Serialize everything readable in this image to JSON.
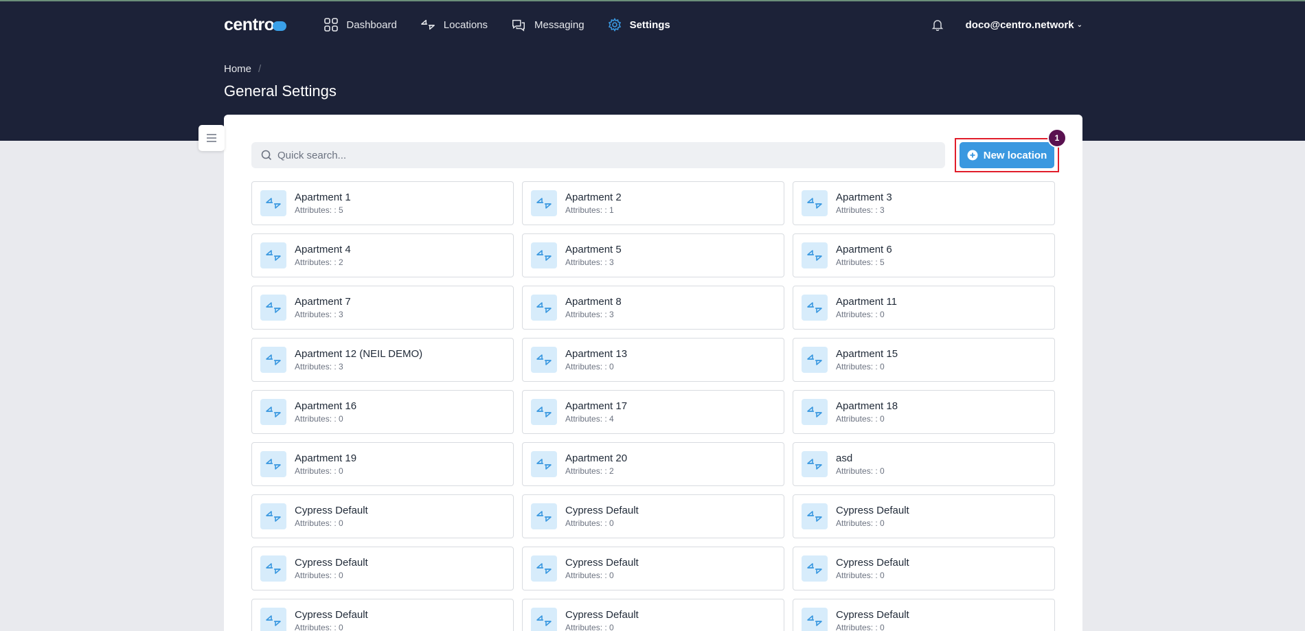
{
  "brand": {
    "logo_text": "centro"
  },
  "nav": {
    "items": [
      {
        "label": "Dashboard",
        "icon": "grid-icon"
      },
      {
        "label": "Locations",
        "icon": "arrows-icon"
      },
      {
        "label": "Messaging",
        "icon": "chat-icon"
      },
      {
        "label": "Settings",
        "icon": "gear-icon",
        "active": true
      }
    ]
  },
  "header": {
    "user_email": "doco@centro.network"
  },
  "breadcrumb": {
    "home": "Home",
    "separator": "/"
  },
  "page": {
    "title": "General Settings"
  },
  "search": {
    "placeholder": "Quick search...",
    "value": ""
  },
  "actions": {
    "new_location_label": "New location",
    "badge": "1"
  },
  "colors": {
    "header_bg": "#1c2238",
    "accent": "#3a98e0",
    "highlight": "#e11d2a",
    "badge": "#5a1150"
  },
  "locations": [
    {
      "name": "Apartment 1",
      "attributes": "Attributes: : 5"
    },
    {
      "name": "Apartment 2",
      "attributes": "Attributes: : 1"
    },
    {
      "name": "Apartment 3",
      "attributes": "Attributes: : 3"
    },
    {
      "name": "Apartment 4",
      "attributes": "Attributes: : 2"
    },
    {
      "name": "Apartment 5",
      "attributes": "Attributes: : 3"
    },
    {
      "name": "Apartment 6",
      "attributes": "Attributes: : 5"
    },
    {
      "name": "Apartment 7",
      "attributes": "Attributes: : 3"
    },
    {
      "name": "Apartment 8",
      "attributes": "Attributes: : 3"
    },
    {
      "name": "Apartment 11",
      "attributes": "Attributes: : 0"
    },
    {
      "name": "Apartment 12 (NEIL DEMO)",
      "attributes": "Attributes: : 3"
    },
    {
      "name": "Apartment 13",
      "attributes": "Attributes: : 0"
    },
    {
      "name": "Apartment 15",
      "attributes": "Attributes: : 0"
    },
    {
      "name": "Apartment 16",
      "attributes": "Attributes: : 0"
    },
    {
      "name": "Apartment 17",
      "attributes": "Attributes: : 4"
    },
    {
      "name": "Apartment 18",
      "attributes": "Attributes: : 0"
    },
    {
      "name": "Apartment 19",
      "attributes": "Attributes: : 0"
    },
    {
      "name": "Apartment 20",
      "attributes": "Attributes: : 2"
    },
    {
      "name": "asd",
      "attributes": "Attributes: : 0"
    },
    {
      "name": "Cypress Default",
      "attributes": "Attributes: : 0"
    },
    {
      "name": "Cypress Default",
      "attributes": "Attributes: : 0"
    },
    {
      "name": "Cypress Default",
      "attributes": "Attributes: : 0"
    },
    {
      "name": "Cypress Default",
      "attributes": "Attributes: : 0"
    },
    {
      "name": "Cypress Default",
      "attributes": "Attributes: : 0"
    },
    {
      "name": "Cypress Default",
      "attributes": "Attributes: : 0"
    },
    {
      "name": "Cypress Default",
      "attributes": "Attributes: : 0"
    },
    {
      "name": "Cypress Default",
      "attributes": "Attributes: : 0"
    },
    {
      "name": "Cypress Default",
      "attributes": "Attributes: : 0"
    }
  ]
}
